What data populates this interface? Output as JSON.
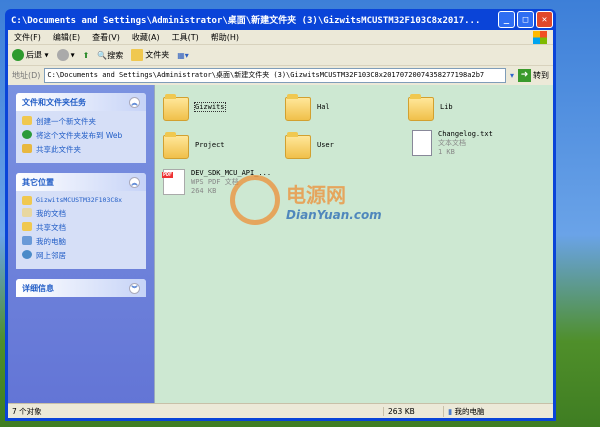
{
  "title": "C:\\Documents and Settings\\Administrator\\桌面\\新建文件夹 (3)\\GizwitsMCUSTM32F103C8x2017...",
  "menu": [
    "文件(F)",
    "编辑(E)",
    "查看(V)",
    "收藏(A)",
    "工具(T)",
    "帮助(H)"
  ],
  "toolbar": {
    "back": "后退",
    "search": "搜索",
    "folders": "文件夹"
  },
  "address": {
    "label": "地址(D)",
    "value": "C:\\Documents and Settings\\Administrator\\桌面\\新建文件夹 (3)\\GizwitsMCUSTM32F103C8x20170720074358277198a2b7",
    "go": "转到"
  },
  "tasks": {
    "title": "文件和文件夹任务",
    "items": [
      "创建一个新文件夹",
      "将这个文件夹发布到 Web",
      "共享此文件夹"
    ]
  },
  "places": {
    "title": "其它位置",
    "items": [
      "GizwitsMCUSTM32F103C8x",
      "我的文档",
      "共享文档",
      "我的电脑",
      "网上邻居"
    ]
  },
  "details": {
    "title": "详细信息"
  },
  "files": [
    {
      "name": "Gizwits"
    },
    {
      "name": "Hal"
    },
    {
      "name": "Lib"
    },
    {
      "name": "Project"
    },
    {
      "name": "User"
    },
    {
      "name": "Changelog.txt",
      "type": "文本文档",
      "size": "1 KB"
    },
    {
      "name": "DEV_SDK_MCU_API_...",
      "type": "WPS PDF 文档",
      "size": "264 KB"
    }
  ],
  "watermark": {
    "cn": "电源网",
    "en": "DianYuan.com"
  },
  "status": {
    "count": "7 个对象",
    "size": "263 KB",
    "location": "我的电脑"
  }
}
